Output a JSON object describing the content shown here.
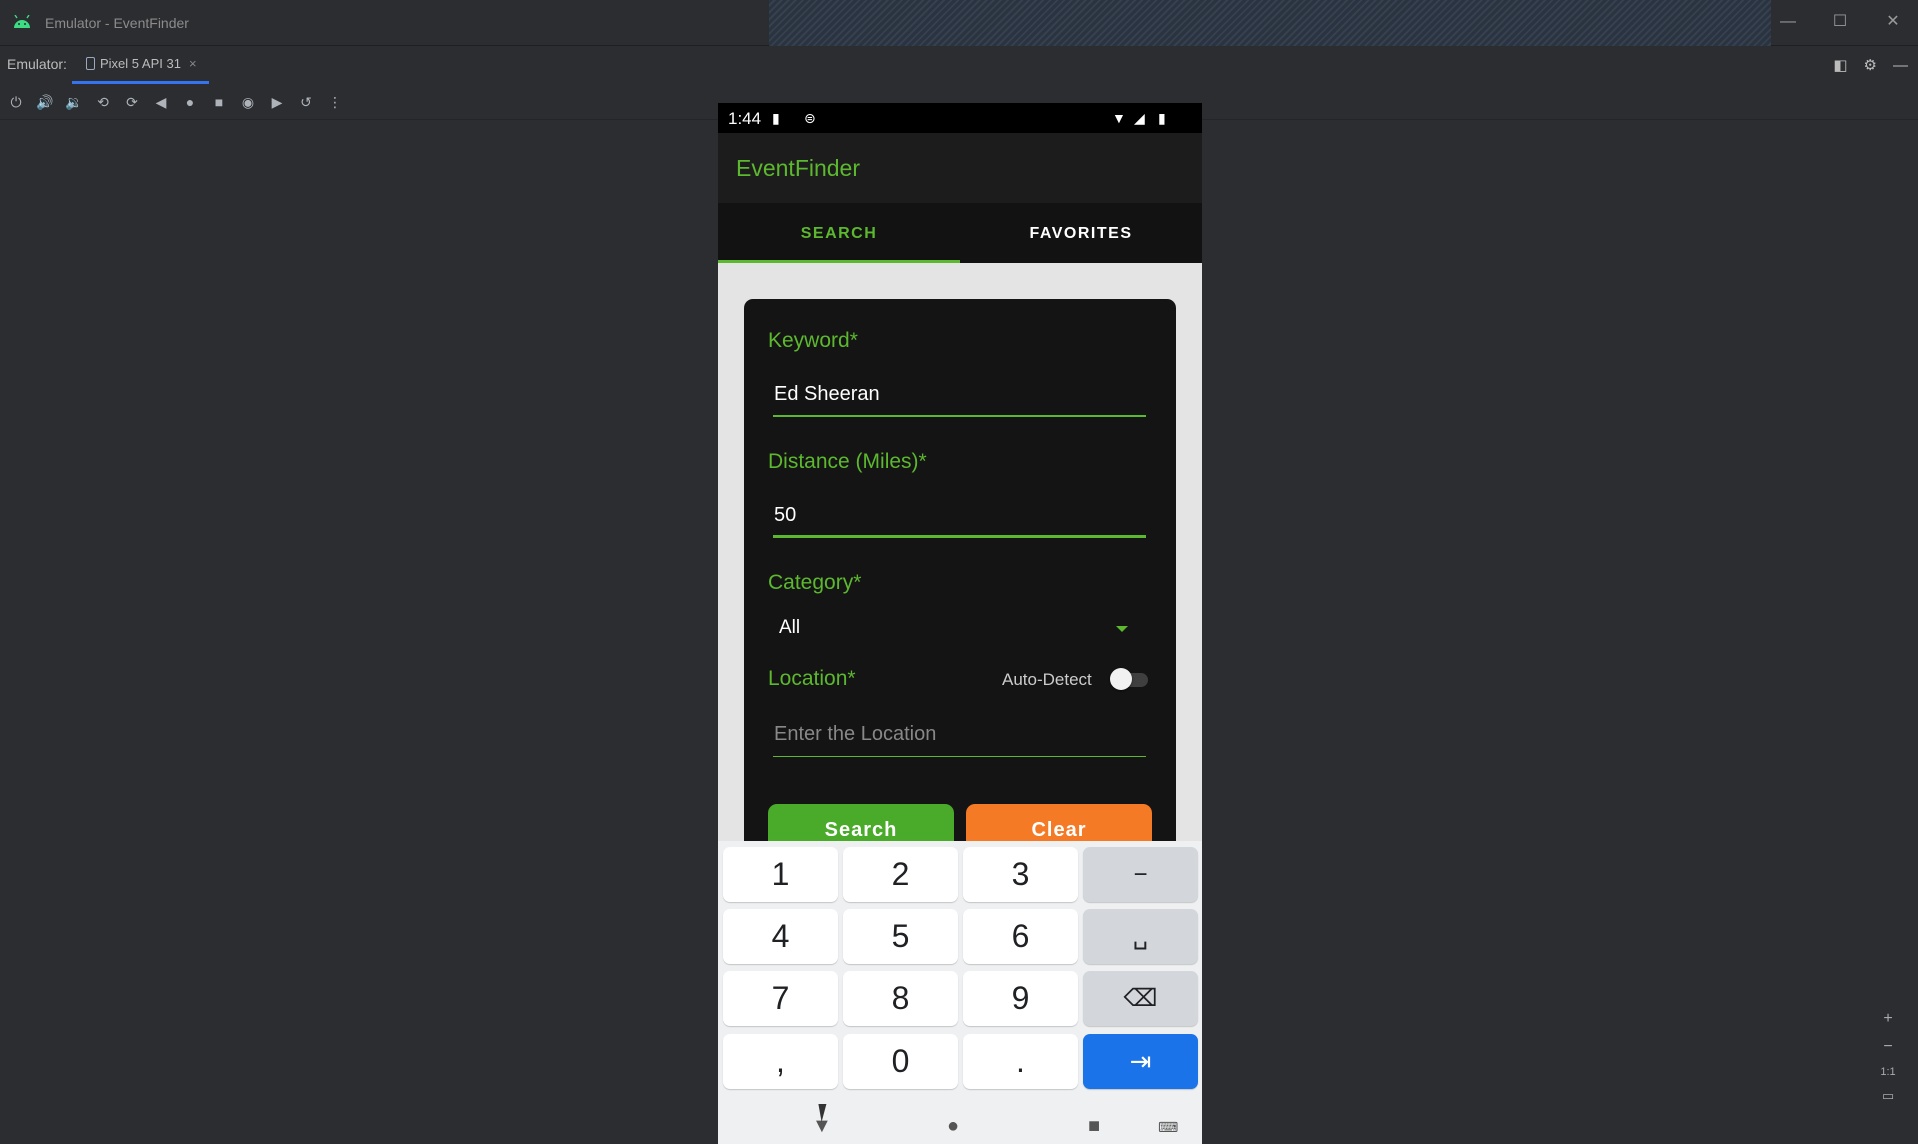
{
  "window": {
    "title": "Emulator - EventFinder",
    "minimize_icon": "minimize-icon",
    "maximize_icon": "maximize-icon",
    "close_icon": "close-icon"
  },
  "tabbar": {
    "label": "Emulator:",
    "device_tab": "Pixel 5 API 31",
    "close_glyph": "×"
  },
  "toolbar": {
    "icons": [
      "power-icon",
      "volume-up-icon",
      "volume-down-icon",
      "rotate-left-icon",
      "rotate-right-icon",
      "back-icon",
      "home-icon",
      "overview-icon",
      "screenshot-icon",
      "record-icon",
      "reset-icon",
      "more-icon"
    ]
  },
  "zoom": {
    "plus": "+",
    "minus": "−",
    "actual": "1:1"
  },
  "phone": {
    "status": {
      "time": "1:44"
    },
    "app_title": "EventFinder",
    "tabs": [
      {
        "label": "SEARCH",
        "active": true
      },
      {
        "label": "FAVORITES",
        "active": false
      }
    ],
    "form": {
      "keyword_label": "Keyword*",
      "keyword_value": "Ed Sheeran",
      "distance_label": "Distance (Miles)*",
      "distance_value": "50",
      "category_label": "Category*",
      "category_value": "All",
      "location_label": "Location*",
      "auto_detect_label": "Auto-Detect",
      "auto_detect_on": false,
      "location_placeholder": "Enter the Location",
      "search_button": "Search",
      "clear_button": "Clear"
    },
    "keyboard": {
      "keys": [
        [
          "1",
          "2",
          "3",
          "−"
        ],
        [
          "4",
          "5",
          "6",
          "␣"
        ],
        [
          "7",
          "8",
          "9",
          "⌫"
        ],
        [
          ",",
          "0",
          ".",
          "⇥"
        ]
      ]
    }
  },
  "colors": {
    "accent_green": "#5cb82e",
    "search_button": "#4aaa2a",
    "clear_button": "#f47a26",
    "enter_key": "#1a73e8"
  }
}
